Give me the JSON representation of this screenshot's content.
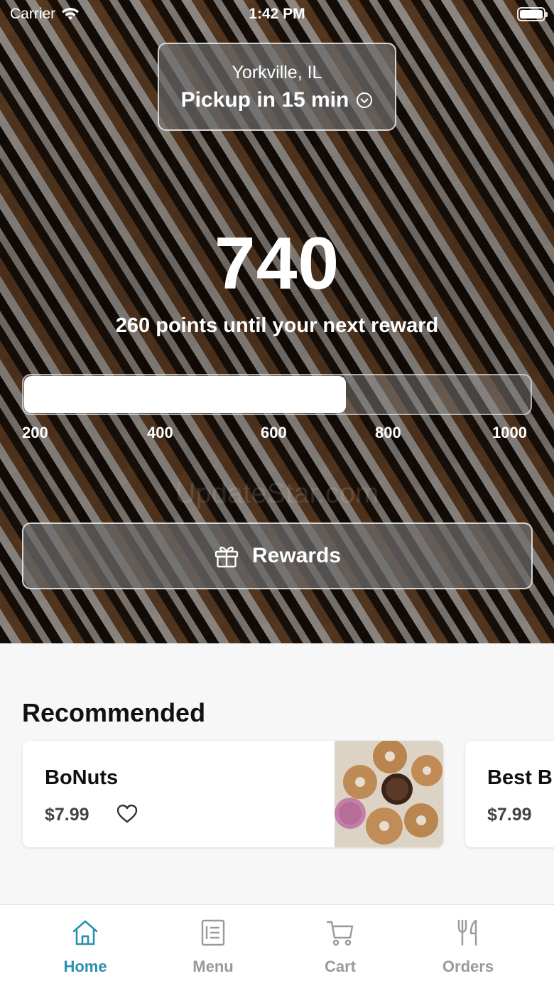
{
  "status_bar": {
    "carrier": "Carrier",
    "time": "1:42 PM"
  },
  "location": {
    "city": "Yorkville, IL",
    "pickup": "Pickup in 15 min"
  },
  "points": {
    "value": "740",
    "subtitle": "260 points until your next reward",
    "progress_fraction": 0.635,
    "ticks": [
      "200",
      "400",
      "600",
      "800",
      "1000"
    ]
  },
  "watermark": "UpdateStar.com",
  "rewards_button": {
    "label": "Rewards"
  },
  "recommended": {
    "title": "Recommended",
    "items": [
      {
        "name": "BoNuts",
        "price": "$7.99"
      },
      {
        "name": "Best B",
        "price": "$7.99"
      }
    ]
  },
  "tabs": [
    {
      "label": "Home",
      "icon": "home-icon",
      "active": true
    },
    {
      "label": "Menu",
      "icon": "menu-icon",
      "active": false
    },
    {
      "label": "Cart",
      "icon": "cart-icon",
      "active": false
    },
    {
      "label": "Orders",
      "icon": "fork-knife-icon",
      "active": false
    }
  ],
  "colors": {
    "accent": "#2b8fb3",
    "inactive": "#9a9a9a"
  }
}
